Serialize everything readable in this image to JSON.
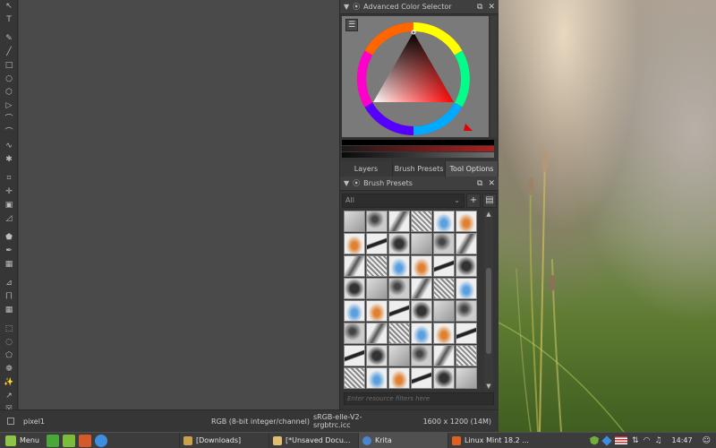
{
  "toolbox": {
    "tools": [
      "select-shapes",
      "text",
      "freehand-brush",
      "line",
      "rectangle",
      "ellipse",
      "polygon",
      "polyline",
      "bezier",
      "freehand-path",
      "dynamic-brush",
      "multibrush",
      "crop",
      "move",
      "transform",
      "warp",
      "fill",
      "color-picker",
      "gradient",
      "measure",
      "assistant",
      "grid",
      "rect-select",
      "ellipse-select",
      "polygon-select",
      "freehand-select",
      "contiguous-select",
      "bezier-select",
      "similar-select"
    ]
  },
  "color_selector": {
    "title": "Advanced Color Selector",
    "menu_icon": "settings-icon"
  },
  "tabs": [
    {
      "label": "Layers",
      "active": false
    },
    {
      "label": "Brush Presets",
      "active": false
    },
    {
      "label": "Tool Options",
      "active": true
    }
  ],
  "brush_presets": {
    "title": "Brush Presets",
    "filter_value": "All",
    "search_placeholder": "Enter resource filters here"
  },
  "statusbar": {
    "brush": "pixel1",
    "color_model": "RGB (8-bit integer/channel)",
    "profile": "sRGB-elle-V2-srgbtrc.icc",
    "image_size": "1600 x 1200 (14M)"
  },
  "taskbar": {
    "menu_label": "Menu",
    "tasks": [
      {
        "label": "[Downloads]",
        "active": false
      },
      {
        "label": "[*Unsaved Docu...",
        "active": false
      },
      {
        "label": "Krita",
        "active": true
      },
      {
        "label": "Linux Mint 18.2 ...",
        "active": false
      }
    ],
    "clock": "14:47"
  },
  "colors": {
    "accent_mint": "#8dc448",
    "dock_bg": "#353535",
    "canvas_bg": "#4a4a4a"
  }
}
